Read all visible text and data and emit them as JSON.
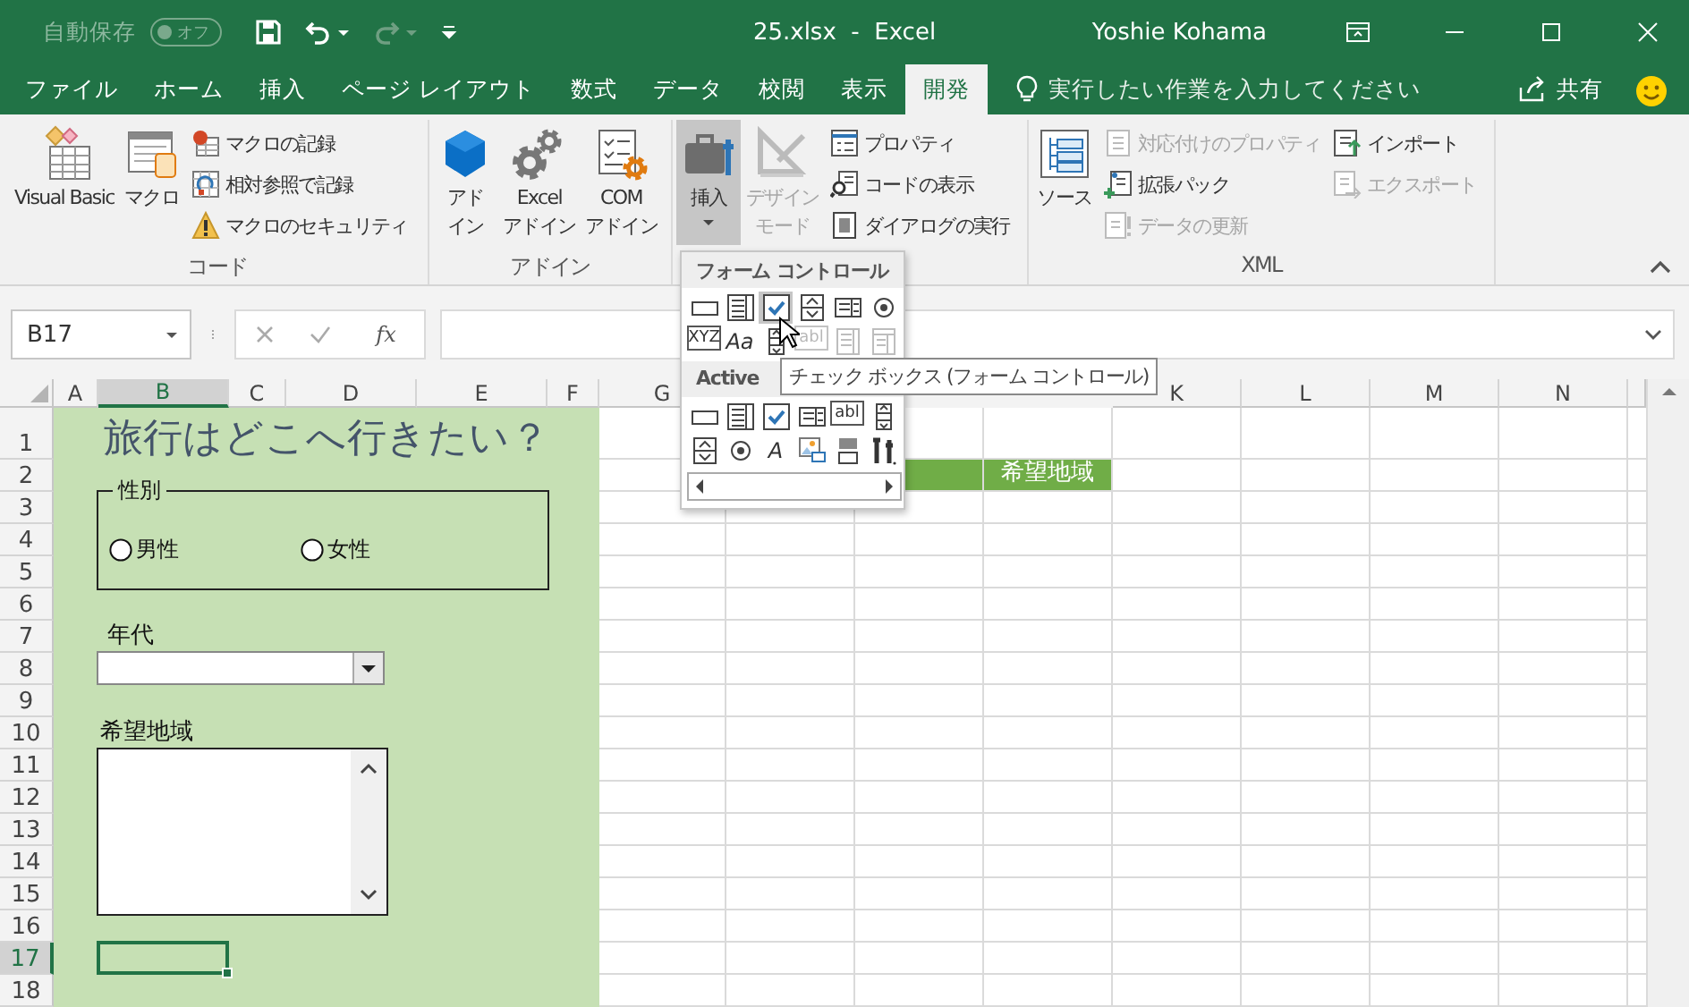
{
  "title_bar": {
    "autosave_label": "自動保存",
    "autosave_state": "オフ",
    "autosave_on": false,
    "title": "25.xlsx  -  Excel",
    "user": "Yoshie Kohama"
  },
  "tabs": [
    {
      "label": "ファイル",
      "selected": false
    },
    {
      "label": "ホーム",
      "selected": false
    },
    {
      "label": "挿入",
      "selected": false
    },
    {
      "label": "ページ レイアウト",
      "selected": false
    },
    {
      "label": "数式",
      "selected": false
    },
    {
      "label": "データ",
      "selected": false
    },
    {
      "label": "校閲",
      "selected": false
    },
    {
      "label": "表示",
      "selected": false
    },
    {
      "label": "開発",
      "selected": true
    }
  ],
  "tell_me": {
    "placeholder": "実行したい作業を入力してください"
  },
  "share": {
    "label": "共有"
  },
  "ribbon": [
    {
      "label": "コード",
      "items": [
        {
          "kind": "large",
          "lines": [
            "Visual Basic"
          ],
          "disabled": false,
          "pressed": false
        },
        {
          "kind": "large",
          "lines": [
            "マクロ"
          ],
          "disabled": false,
          "pressed": false
        },
        {
          "kind": "stack",
          "items": [
            {
              "label": "マクロの記録",
              "disabled": false
            },
            {
              "label": "相対参照で記録",
              "disabled": false
            },
            {
              "label": "マクロのセキュリティ",
              "disabled": false
            }
          ]
        }
      ]
    },
    {
      "label": "アドイン",
      "items": [
        {
          "kind": "large",
          "lines": [
            "アド",
            "イン"
          ],
          "disabled": false,
          "pressed": false
        },
        {
          "kind": "large",
          "lines": [
            "Excel",
            "アドイン"
          ],
          "disabled": false,
          "pressed": false
        },
        {
          "kind": "large",
          "lines": [
            "COM",
            "アドイン"
          ],
          "disabled": false,
          "pressed": false
        }
      ]
    },
    {
      "items": [
        {
          "kind": "dropdown",
          "lines": [
            "挿入"
          ],
          "disabled": false,
          "pressed": true
        },
        {
          "kind": "large",
          "lines": [
            "デザイン",
            "モード"
          ],
          "disabled": true,
          "pressed": false
        },
        {
          "kind": "stack",
          "items": [
            {
              "label": "プロパティ",
              "disabled": false
            },
            {
              "label": "コードの表示",
              "disabled": false
            },
            {
              "label": "ダイアログの実行",
              "disabled": false
            }
          ]
        }
      ]
    },
    {
      "label": "XML",
      "items": [
        {
          "kind": "large",
          "lines": [
            "ソース"
          ],
          "disabled": false,
          "pressed": false
        },
        {
          "kind": "stack",
          "items": [
            {
              "label": "対応付けのプロパティ",
              "disabled": true
            },
            {
              "label": "拡張パック",
              "disabled": false
            },
            {
              "label": "データの更新",
              "disabled": true
            }
          ]
        },
        {
          "kind": "stack",
          "items": [
            {
              "label": "インポート",
              "disabled": false
            },
            {
              "label": "エクスポート",
              "disabled": true
            }
          ]
        }
      ]
    }
  ],
  "formula_bar": {
    "name_box": "B17",
    "fx_label": "fx"
  },
  "sheet": {
    "columns": [
      {
        "label": "A",
        "selected": false
      },
      {
        "label": "B",
        "selected": true
      },
      {
        "label": "C",
        "selected": false
      },
      {
        "label": "D",
        "selected": false
      },
      {
        "label": "E",
        "selected": false
      },
      {
        "label": "F",
        "selected": false
      },
      {
        "label": "G",
        "selected": false
      },
      {},
      {},
      {},
      {
        "label": "K",
        "selected": false
      },
      {
        "label": "L",
        "selected": false
      },
      {
        "label": "M",
        "selected": false
      },
      {
        "label": "N",
        "selected": false
      }
    ],
    "rows": [
      {
        "label": "1",
        "selected": false
      },
      {
        "label": "2",
        "selected": false
      },
      {
        "label": "3",
        "selected": false
      },
      {
        "label": "4",
        "selected": false
      },
      {
        "label": "5",
        "selected": false
      },
      {
        "label": "6",
        "selected": false
      },
      {
        "label": "7",
        "selected": false
      },
      {
        "label": "8",
        "selected": false
      },
      {
        "label": "9",
        "selected": false
      },
      {
        "label": "10",
        "selected": false
      },
      {
        "label": "11",
        "selected": false
      },
      {
        "label": "12",
        "selected": false
      },
      {
        "label": "13",
        "selected": false
      },
      {
        "label": "14",
        "selected": false
      },
      {
        "label": "15",
        "selected": false
      },
      {
        "label": "16",
        "selected": false
      },
      {
        "label": "17",
        "selected": true
      },
      {
        "label": "18",
        "selected": false
      }
    ],
    "banner": {
      "text": "希望地域"
    }
  },
  "form": {
    "title": "旅行はどこへ行きたい？",
    "gender": {
      "label": "性別",
      "options": [
        {
          "label": "男性",
          "selected": false
        },
        {
          "label": "女性",
          "selected": false
        }
      ]
    },
    "age": {
      "label": "年代"
    },
    "region": {
      "label": "希望地域"
    }
  },
  "controls_menu": {
    "form_heading": "フォーム コントロール",
    "form_controls": [
      {
        "disabled": false,
        "selected": false
      },
      {
        "disabled": false,
        "selected": false
      },
      {
        "disabled": false,
        "selected": true
      },
      {
        "disabled": false,
        "selected": false
      },
      {
        "disabled": false,
        "selected": false
      },
      {
        "disabled": false,
        "selected": false
      },
      {
        "disabled": false,
        "selected": false,
        "glyph": "XYZ"
      },
      {
        "disabled": false,
        "selected": false,
        "glyph": "Aa"
      },
      {
        "disabled": false,
        "selected": false
      },
      {
        "disabled": true,
        "selected": false,
        "glyph": "abl"
      },
      {
        "disabled": true,
        "selected": false
      },
      {
        "disabled": true,
        "selected": false
      }
    ],
    "activex_heading": "Active",
    "activex_controls": [
      {
        "disabled": false,
        "selected": false
      },
      {
        "disabled": false,
        "selected": false
      },
      {
        "disabled": false,
        "selected": false
      },
      {
        "disabled": false,
        "selected": false
      },
      {
        "disabled": false,
        "selected": false,
        "glyph": "abl"
      },
      {
        "disabled": false,
        "selected": false
      },
      {
        "disabled": false,
        "selected": false
      },
      {
        "disabled": false,
        "selected": false
      },
      {
        "disabled": false,
        "selected": false,
        "glyph": "A"
      },
      {
        "disabled": false,
        "selected": false
      },
      {
        "disabled": false,
        "selected": false
      },
      {
        "disabled": false,
        "selected": false
      },
      {
        "disabled": false,
        "selected": false
      }
    ],
    "tooltip": "チェック ボックス (フォーム コントロール)"
  }
}
